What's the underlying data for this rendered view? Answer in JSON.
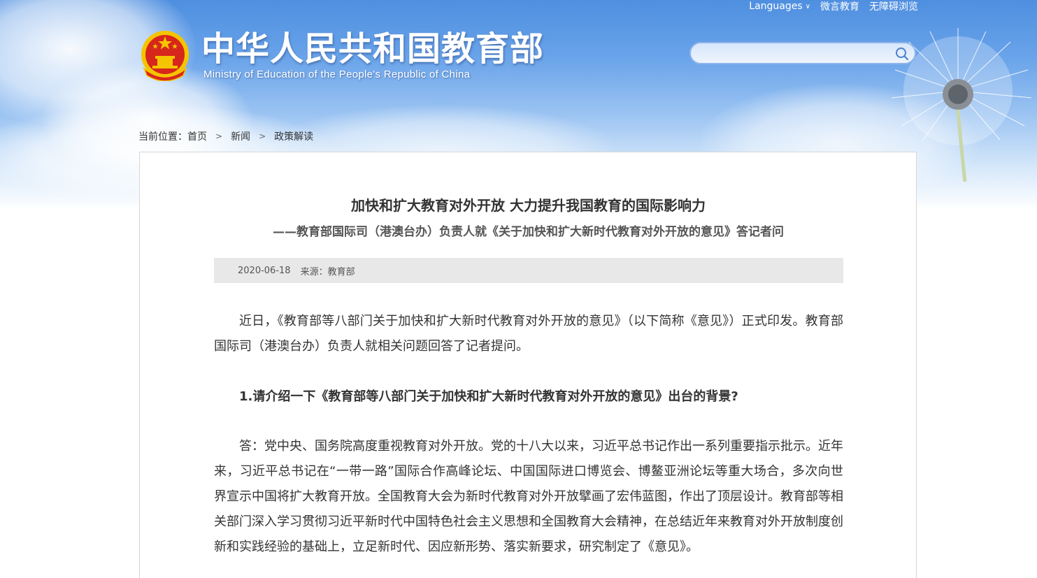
{
  "header": {
    "languages_label": "Languages",
    "weiyan_label": "微言教育",
    "accessibility_label": "无障碍浏览",
    "site_title": "中华人民共和国教育部",
    "site_subtitle": "Ministry of Education of the People's Republic of China",
    "search_placeholder": ""
  },
  "breadcrumb": {
    "prefix": "当前位置：",
    "items": [
      "首页",
      "新闻",
      "政策解读"
    ]
  },
  "article": {
    "title": "加快和扩大教育对外开放 大力提升我国教育的国际影响力",
    "subtitle": "——教育部国际司（港澳台办）负责人就《关于加快和扩大新时代教育对外开放的意见》答记者问",
    "date": "2020-06-18",
    "source": "来源：教育部",
    "paragraphs": [
      "近日，《教育部等八部门关于加快和扩大新时代教育对外开放的意见》（以下简称《意见》）正式印发。教育部国际司（港澳台办）负责人就相关问题回答了记者提问。",
      "1.请介绍一下《教育部等八部门关于加快和扩大新时代教育对外开放的意见》出台的背景?",
      "答：党中央、国务院高度重视教育对外开放。党的十八大以来，习近平总书记作出一系列重要指示批示。近年来，习近平总书记在“一带一路”国际合作高峰论坛、中国国际进口博览会、博鳌亚洲论坛等重大场合，多次向世界宣示中国将扩大教育开放。全国教育大会为新时代教育对外开放擘画了宏伟蓝图，作出了顶层设计。教育部等相关部门深入学习贯彻习近平新时代中国特色社会主义思想和全国教育大会精神，在总结近年来教育对外开放制度创新和实践经验的基础上，立足新时代、因应新形势、落实新要求，研究制定了《意见》。"
    ]
  },
  "colors": {
    "sky_top": "#4f8fe0",
    "text_main": "#333333",
    "meta_bg": "#e8e8e8",
    "emblem_red": "#d7261c",
    "emblem_gold": "#f5c400"
  },
  "icons": {
    "emblem": "national-emblem-icon",
    "search": "search-icon",
    "chevron": "chevron-down-icon"
  }
}
